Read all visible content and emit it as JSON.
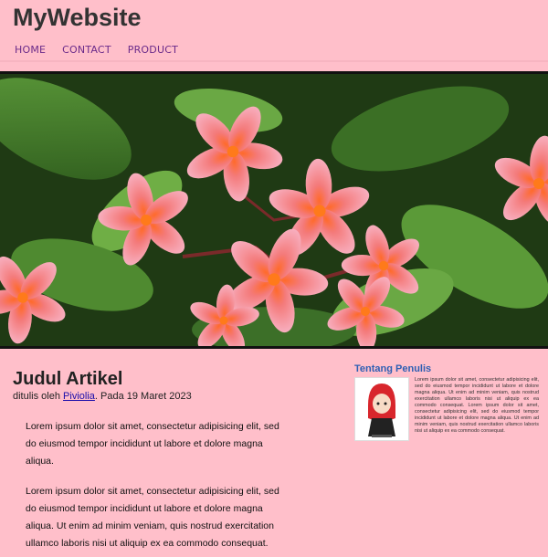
{
  "site": {
    "title": "MyWebsite"
  },
  "nav": {
    "items": [
      "HOME",
      "CONTACT",
      "PRODUCT"
    ]
  },
  "article": {
    "title": "Judul Artikel",
    "byline_prefix": "ditulis oleh ",
    "author": "Piviolia",
    "byline_suffix": ". Pada 19 Maret 2023",
    "paragraphs": [
      "Lorem ipsum dolor sit amet, consectetur adipisicing elit, sed do eiusmod tempor incididunt ut labore et dolore magna aliqua.",
      "Lorem ipsum dolor sit amet, consectetur adipisicing elit, sed do eiusmod tempor incididunt ut labore et dolore magna aliqua. Ut enim ad minim veniam, quis nostrud exercitation ullamco laboris nisi ut aliquip ex ea commodo consequat."
    ]
  },
  "sidebar": {
    "heading": "Tentang Penulis",
    "bio": "Lorem ipsum dolor sit amet, consectetur adipisicing elit, sed do eiusmod tempor incididunt ut labore et dolore magna aliqua. Ut enim ad minim veniam, quis nostrud exercitation ullamco laboris nisi ut aliquip ex ea commodo consequat. Lorem ipsum dolor sit amet, consectetur adipisicing elit, sed do eiusmod tempor incididunt ut labore et dolore magna aliqua. Ut enim ad minim veniam, quis nostrud exercitation ullamco laboris nisi ut aliquip ex ea commodo consequat."
  },
  "colors": {
    "background": "#ffbfca",
    "link": "#1a0dab",
    "nav": "#6b2b8a",
    "sidebar_heading": "#2f5fb3"
  }
}
